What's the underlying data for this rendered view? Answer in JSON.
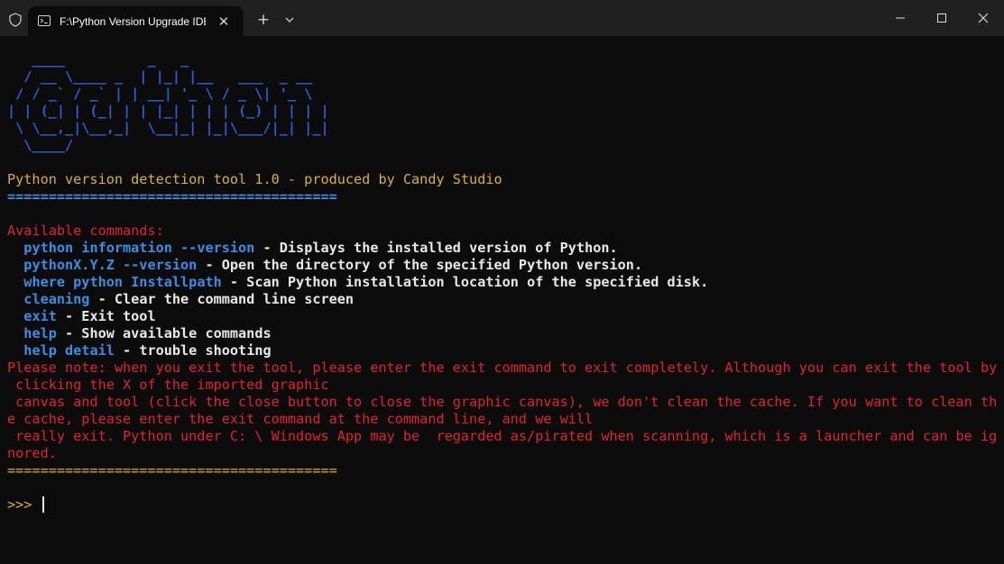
{
  "window": {
    "tab_title": "F:\\Python Version Upgrade IDE",
    "tab_close": "✕",
    "new_tab": "+"
  },
  "colors": {
    "art": "#2b5fd9",
    "title": "#d9b233",
    "command": "#3a8ee6",
    "warning": "#e0242e",
    "text": "#e8e8e8",
    "background": "#0c0c0c"
  },
  "ascii_art": [
    "   ____          _   _",
    "  / __ \\____ _  | |_| |__   ___  _ __",
    " / / _` / _` | | __| '_ \\ / _ \\| '_ \\",
    "| | (_| | (_| | | |_| | | | (_) | | | |",
    " \\ \\__,_|\\__,_|  \\__|_| |_|\\___/|_| |_|",
    "  \\____/"
  ],
  "header": {
    "title": "Python version detection tool 1.0 - produced by Candy Studio",
    "separator": "========================================"
  },
  "commands_heading": "Available commands:",
  "commands": [
    {
      "cmd": "python information --version",
      "desc": " - Displays the installed version of Python."
    },
    {
      "cmd": "pythonX.Y.Z --version",
      "desc": " - Open the directory of the specified Python version."
    },
    {
      "cmd": "where python Installpath",
      "desc": " - Scan Python installation location of the specified disk."
    },
    {
      "cmd": "cleaning",
      "desc": " - Clear the command line screen"
    },
    {
      "cmd": "exit",
      "desc": " - Exit tool"
    },
    {
      "cmd": "help",
      "desc": " - Show available commands"
    },
    {
      "cmd": "help detail",
      "desc": " - trouble shooting"
    }
  ],
  "notice_lines": [
    "Please note: when you exit the tool, please enter the exit command to exit completely. Although you can exit the tool by",
    " clicking the X of the imported graphic",
    " canvas and tool (click the close button to close the graphic canvas), we don't clean the cache. If you want to clean th",
    "e cache, please enter the exit command at the command line, and we will",
    " really exit. Python under C: \\ Windows App may be  regarded as/pirated when scanning, which is a launcher and can be ig",
    "nored."
  ],
  "footer_separator": "========================================",
  "prompt": ">>>"
}
